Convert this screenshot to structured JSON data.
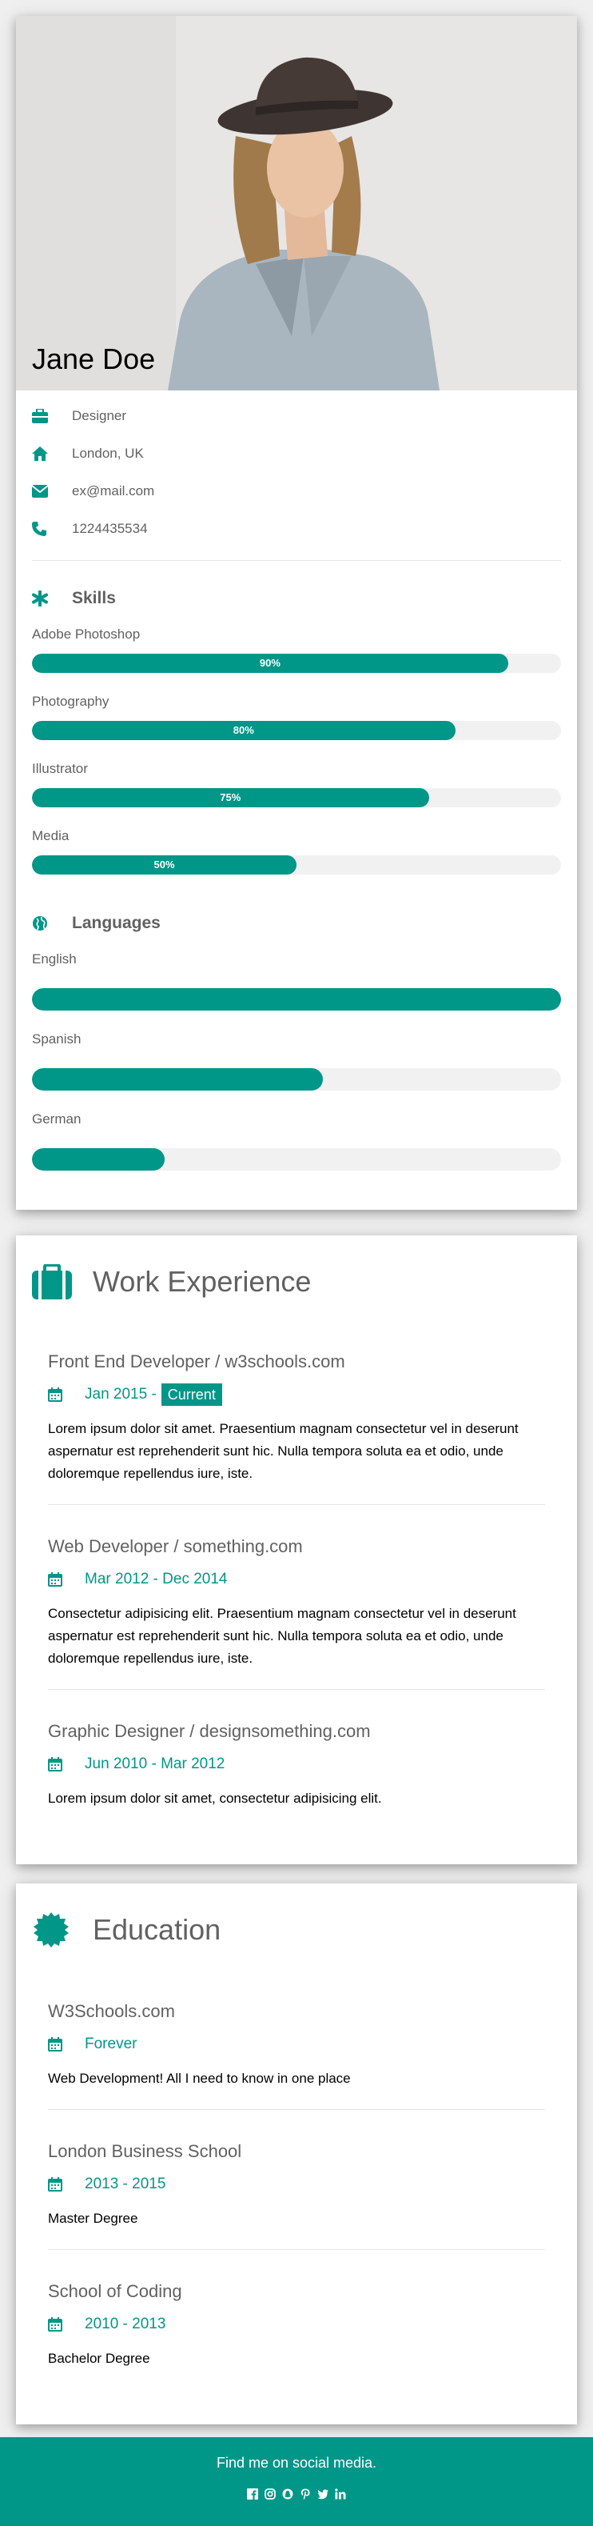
{
  "profile": {
    "name": "Jane Doe",
    "contact": [
      {
        "icon": "briefcase-icon",
        "text": "Designer"
      },
      {
        "icon": "home-icon",
        "text": "London, UK"
      },
      {
        "icon": "envelope-icon",
        "text": "ex@mail.com"
      },
      {
        "icon": "phone-icon",
        "text": "1224435534"
      }
    ]
  },
  "skills": {
    "title": "Skills",
    "icon": "asterisk-icon",
    "items": [
      {
        "label": "Adobe Photoshop",
        "percent": 90,
        "percent_label": "90%"
      },
      {
        "label": "Photography",
        "percent": 80,
        "percent_label": "80%"
      },
      {
        "label": "Illustrator",
        "percent": 75,
        "percent_label": "75%"
      },
      {
        "label": "Media",
        "percent": 50,
        "percent_label": "50%"
      }
    ]
  },
  "languages": {
    "title": "Languages",
    "icon": "globe-icon",
    "items": [
      {
        "label": "English",
        "percent": 100
      },
      {
        "label": "Spanish",
        "percent": 55
      },
      {
        "label": "German",
        "percent": 25
      }
    ]
  },
  "work": {
    "title": "Work Experience",
    "icon": "suitcase-icon",
    "entries": [
      {
        "title": "Front End Developer / w3schools.com",
        "date": "Jan 2015 -",
        "tag": "Current",
        "desc": "Lorem ipsum dolor sit amet. Praesentium magnam consectetur vel in deserunt aspernatur est reprehenderit sunt hic. Nulla tempora soluta ea et odio, unde doloremque repellendus iure, iste."
      },
      {
        "title": "Web Developer / something.com",
        "date": "Mar 2012 - Dec 2014",
        "desc": "Consectetur adipisicing elit. Praesentium magnam consectetur vel in deserunt aspernatur est reprehenderit sunt hic. Nulla tempora soluta ea et odio, unde doloremque repellendus iure, iste."
      },
      {
        "title": "Graphic Designer / designsomething.com",
        "date": "Jun 2010 - Mar 2012",
        "desc": "Lorem ipsum dolor sit amet, consectetur adipisicing elit."
      }
    ]
  },
  "education": {
    "title": "Education",
    "icon": "certificate-icon",
    "entries": [
      {
        "title": "W3Schools.com",
        "date": "Forever",
        "desc": "Web Development! All I need to know in one place"
      },
      {
        "title": "London Business School",
        "date": "2013 - 2015",
        "desc": "Master Degree"
      },
      {
        "title": "School of Coding",
        "date": "2010 - 2013",
        "desc": "Bachelor Degree"
      }
    ]
  },
  "footer": {
    "text": "Find me on social media.",
    "socials": [
      "facebook-icon",
      "instagram-icon",
      "snapchat-icon",
      "pinterest-icon",
      "twitter-icon",
      "linkedin-icon"
    ]
  },
  "colors": {
    "accent": "#009688",
    "text_muted": "#616161",
    "bar_track": "#f1f1f1"
  }
}
